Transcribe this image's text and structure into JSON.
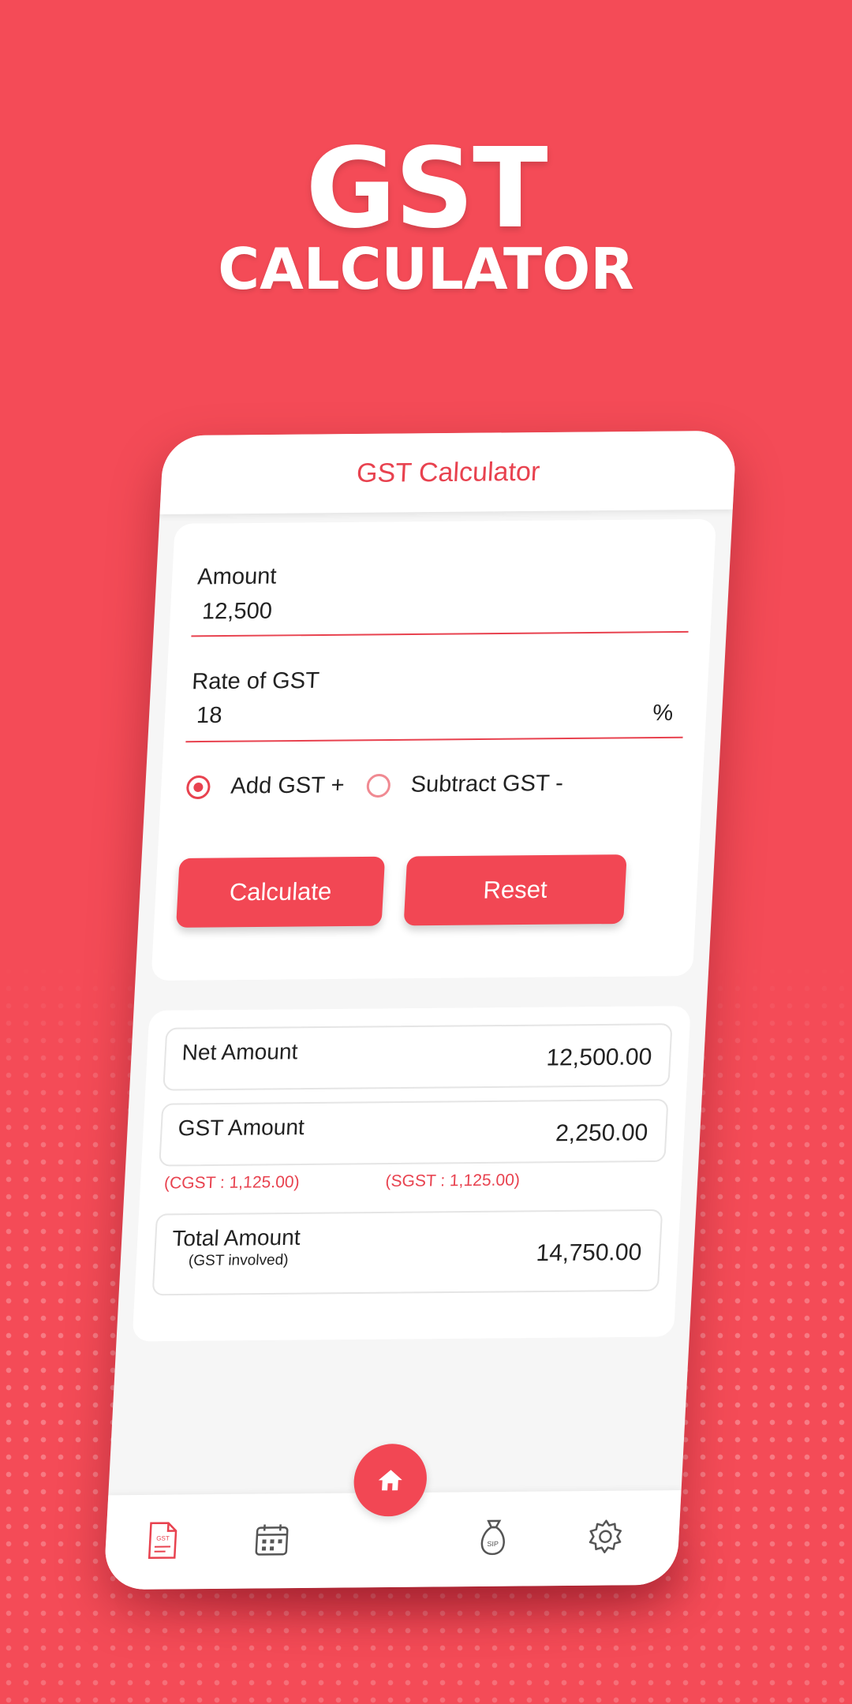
{
  "hero": {
    "title": "GST",
    "subtitle": "CALCULATOR"
  },
  "app": {
    "title": "GST Calculator",
    "accent_color": "#e8424f",
    "background_color": "#f44b57"
  },
  "form": {
    "amount_label": "Amount",
    "amount_value": "12,500",
    "rate_label": "Rate of GST",
    "rate_value": "18",
    "rate_unit": "%",
    "options": [
      {
        "label": "Add GST +",
        "selected": true
      },
      {
        "label": "Subtract GST -",
        "selected": false
      }
    ],
    "calculate_label": "Calculate",
    "reset_label": "Reset"
  },
  "results": {
    "net_label": "Net Amount",
    "net_value": "12,500.00",
    "gst_label": "GST Amount",
    "gst_value": "2,250.00",
    "cgst_text": "(CGST : 1,125.00)",
    "sgst_text": "(SGST : 1,125.00)",
    "total_label": "Total Amount",
    "total_sub": "(GST involved)",
    "total_value": "14,750.00"
  },
  "nav": {
    "items": [
      {
        "icon": "gst-document-icon",
        "badge": "GST",
        "active": true
      },
      {
        "icon": "calendar-icon",
        "active": false
      },
      {
        "icon": "home-icon",
        "active": false
      },
      {
        "icon": "sip-money-bag-icon",
        "badge": "SIP",
        "active": false
      },
      {
        "icon": "gear-icon",
        "active": false
      }
    ]
  }
}
